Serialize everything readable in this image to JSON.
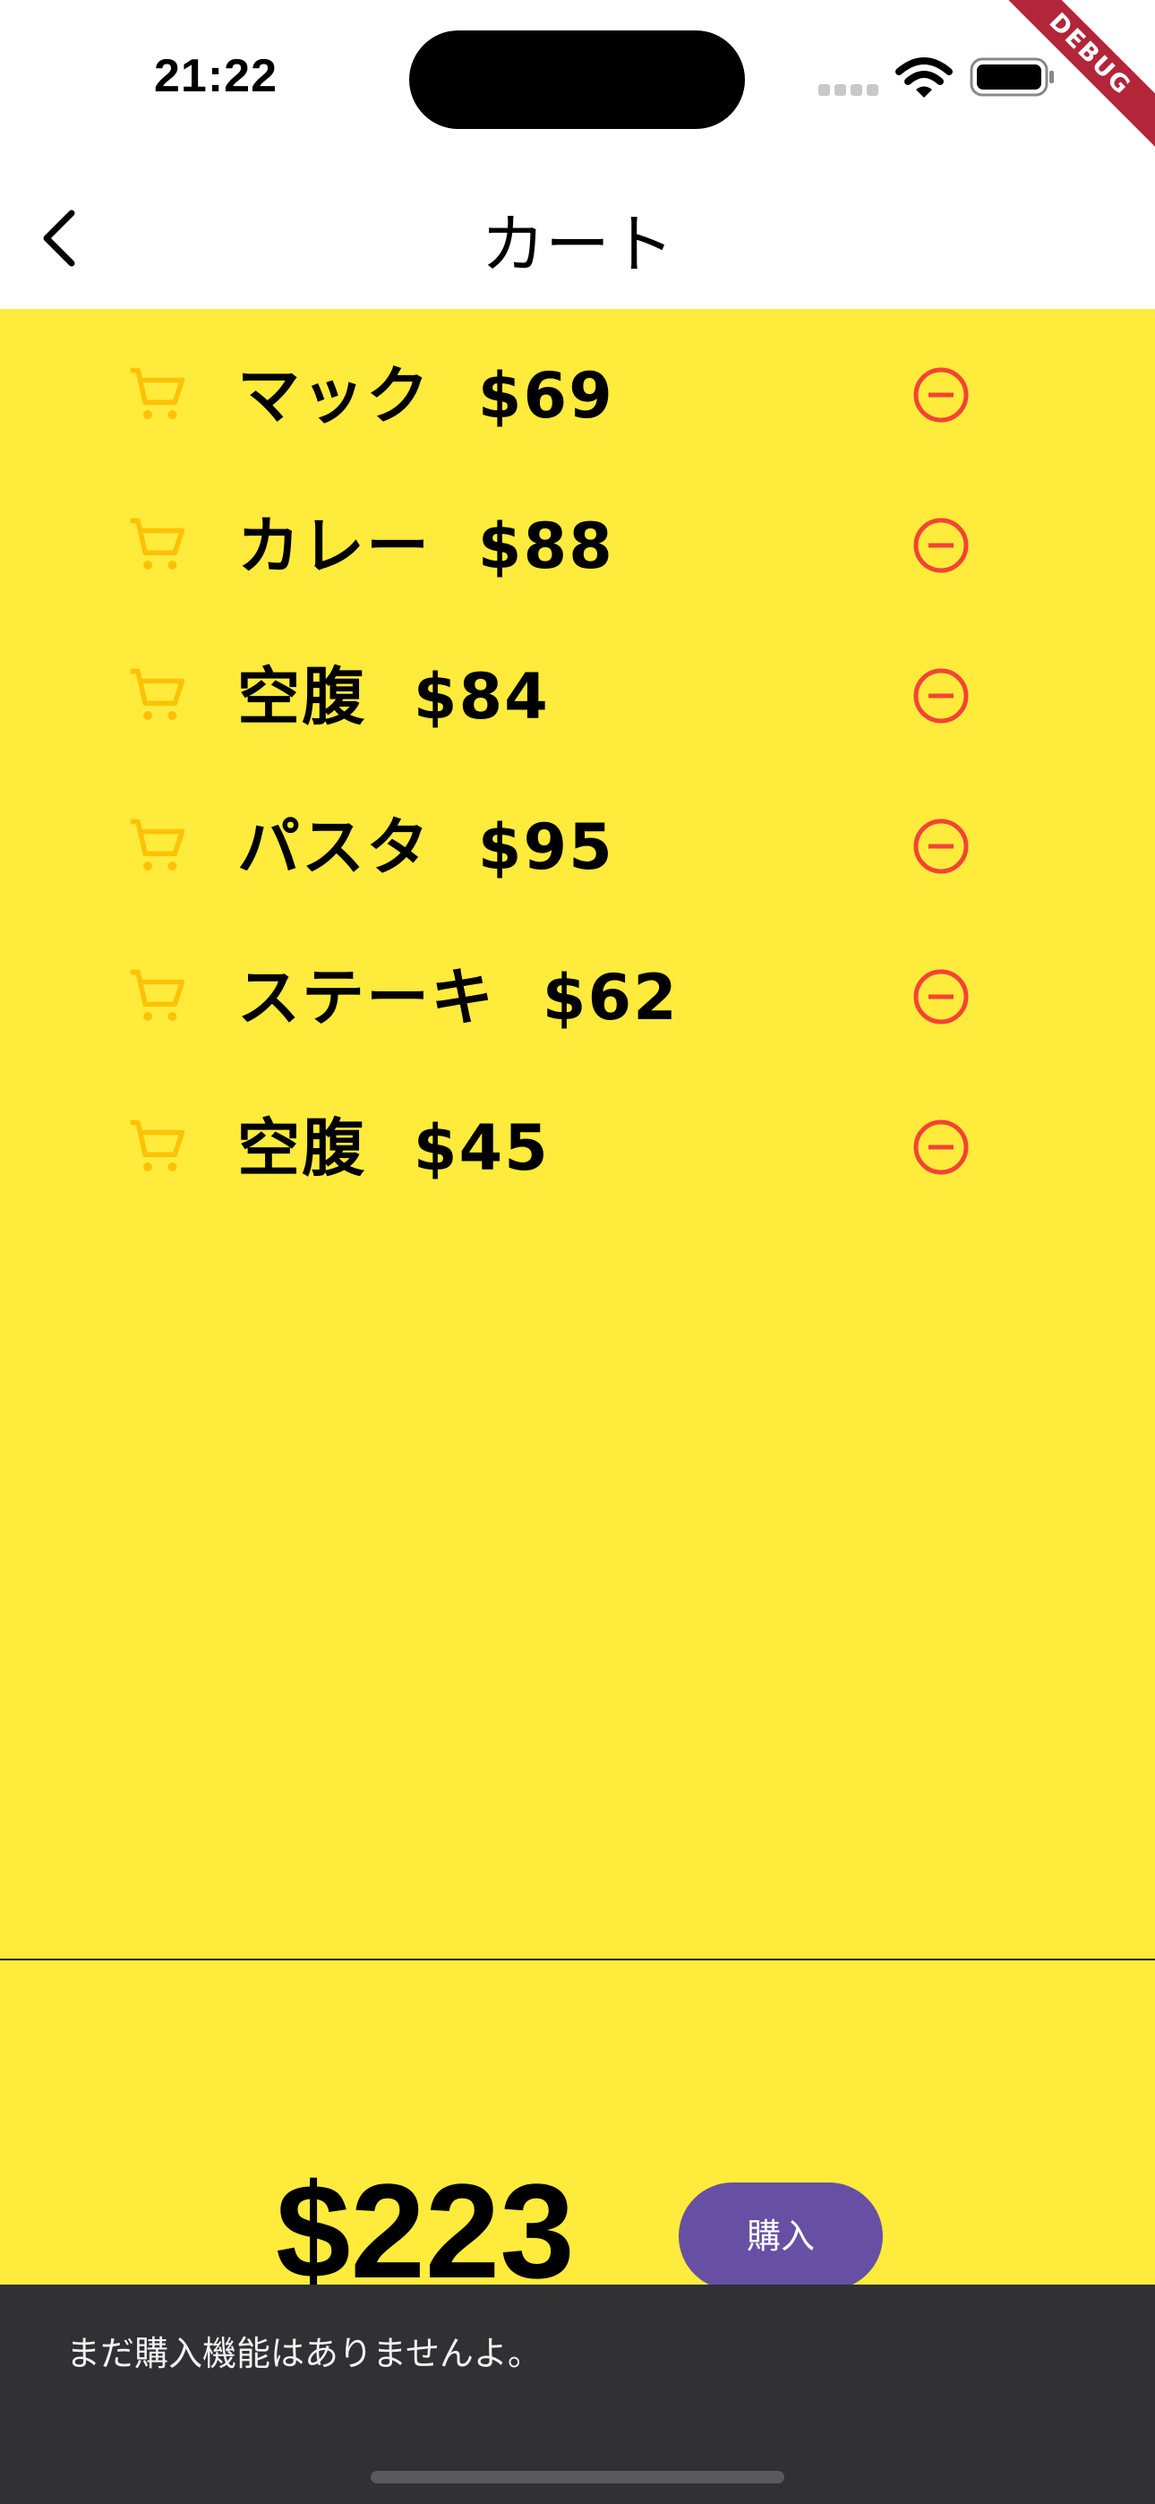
{
  "status_bar": {
    "time": "21:22",
    "icons": [
      "cellular-signal-icon",
      "wifi-icon",
      "battery-icon"
    ]
  },
  "debug_banner": "DEBUG",
  "app_bar": {
    "title": "カート",
    "back_icon": "chevron-left-icon"
  },
  "cart": {
    "items": [
      {
        "label": "マック  $69"
      },
      {
        "label": "カレー  $88"
      },
      {
        "label": "空腹  $84"
      },
      {
        "label": "パスタ  $95"
      },
      {
        "label": "ステーキ  $62"
      },
      {
        "label": "空腹  $45"
      }
    ],
    "item_icon": "shopping-cart-icon",
    "remove_icon": "remove-circle-outline-icon"
  },
  "footer": {
    "total": "$223",
    "buy_label": "購入"
  },
  "snackbar": {
    "message": "まだ購入機能はありませんよ。"
  },
  "colors": {
    "background": "#FFEB3B",
    "cart_icon": "#FFC107",
    "remove_icon": "#F44336",
    "buy_button": "#6750A4",
    "snackbar": "#313033",
    "debug_ribbon": "#B3263A"
  }
}
